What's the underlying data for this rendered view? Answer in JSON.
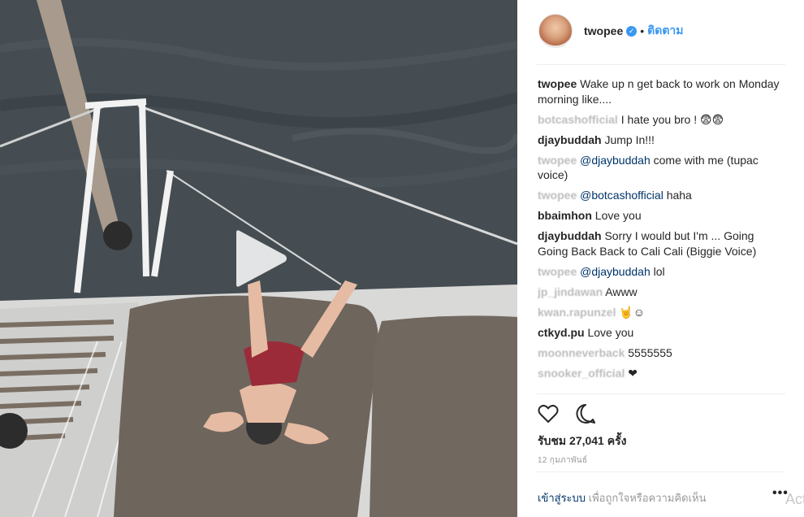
{
  "post": {
    "username": "twopee",
    "verified_mark": "✓",
    "separator": "•",
    "follow_label": "ติดตาม"
  },
  "caption": {
    "author": "twopee",
    "text": "Wake up n get back to work on Monday morning like...."
  },
  "comments": [
    {
      "author": "botcashofficial",
      "mention": "",
      "text": "I hate you bro ! 😨😨"
    },
    {
      "author": "djaybuddah",
      "mention": "",
      "text": "Jump In!!!"
    },
    {
      "author": "twopee",
      "mention": "@djaybuddah",
      "text": "come with me (tupac voice)"
    },
    {
      "author": "twopee",
      "mention": "@botcashofficial",
      "text": "haha"
    },
    {
      "author": "bbaimhon",
      "mention": "",
      "text": "Love you"
    },
    {
      "author": "djaybuddah",
      "mention": "",
      "text": "Sorry I would but I'm ... Going Going Back Back to Cali Cali (Biggie Voice)"
    },
    {
      "author": "twopee",
      "mention": "@djaybuddah",
      "text": "lol"
    },
    {
      "author": "jp_jindawan",
      "mention": "",
      "text": "Awww"
    },
    {
      "author": "kwan.rapunzel",
      "mention": "",
      "text": "🤘☺"
    },
    {
      "author": "ctkyd.pu",
      "mention": "",
      "text": "Love you"
    },
    {
      "author": "moonneverback",
      "mention": "",
      "text": "5555555"
    },
    {
      "author": "snooker_official",
      "mention": "",
      "text": "❤"
    }
  ],
  "stats": {
    "views": "รับชม 27,041 ครั้ง",
    "date": "12 กุมภาพันธ์"
  },
  "login": {
    "link": "เข้าสู่ระบบ",
    "text": "เพื่อถูกใจหรือความคิดเห็น",
    "more": "•••"
  },
  "watermark": "Act",
  "icons": {
    "like": "heart-icon",
    "comment": "comment-icon",
    "play": "play-icon"
  }
}
